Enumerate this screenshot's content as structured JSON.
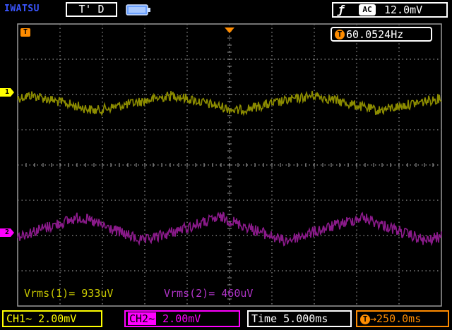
{
  "header": {
    "brand": "IWATSU",
    "mode": "T' D",
    "trigger": {
      "slope_icon": "rising-edge-icon",
      "coupling": "AC",
      "level": "12.0mV"
    }
  },
  "readouts": {
    "frequency_tag": "T",
    "frequency": "60.0524Hz"
  },
  "markers": {
    "trigger_left_tag": "T",
    "ch1_tag": "1",
    "ch2_tag": "2"
  },
  "measurements": {
    "ch1": "Vrms(1)= 933uV",
    "ch2": "Vrms(2)= 460uV"
  },
  "footer": {
    "ch1_scale": "CH1~ 2.00mV",
    "ch2_tag": "CH2~",
    "ch2_scale": "2.00mV",
    "timebase": "Time 5.000ms",
    "delay_tag": "T",
    "delay": "→250.0ms"
  },
  "colors": {
    "ch1": "#ffff00",
    "ch1_trace": "#8c8c00",
    "ch2": "#ff00ff",
    "ch2_trace": "#8a1a8a",
    "trigger": "#ff8c00"
  }
}
